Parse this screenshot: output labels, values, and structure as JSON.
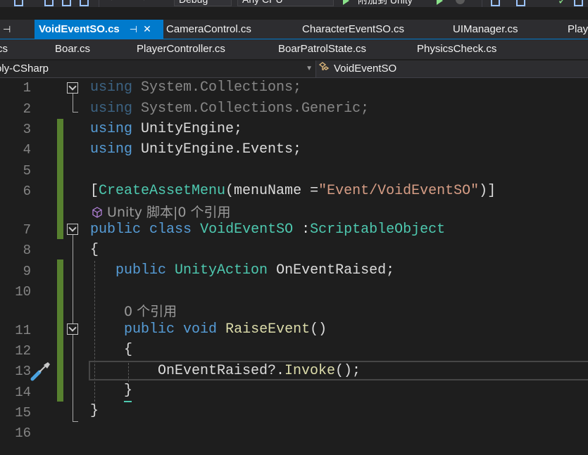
{
  "toolbar": {
    "config": "Debug",
    "platform": "Any CPU",
    "attach_label": "附加到 Unity"
  },
  "tabs_row1": [
    {
      "label": "VoidEventSO.cs",
      "active": true,
      "pin": "⊣",
      "close": "✕"
    },
    {
      "label": "CameraControl.cs"
    },
    {
      "label": "CharacterEventSO.cs"
    },
    {
      "label": "UIManager.cs"
    },
    {
      "label": "Play"
    }
  ],
  "tabs_row2": [
    {
      "label": "cs"
    },
    {
      "label": "Boar.cs"
    },
    {
      "label": "PlayerController.cs"
    },
    {
      "label": "BoarPatrolState.cs"
    },
    {
      "label": "PhysicsCheck.cs"
    }
  ],
  "navbar": {
    "project": "oly-CSharp",
    "class_name": "VoidEventSO"
  },
  "editor": {
    "line_numbers": [
      "1",
      "2",
      "3",
      "4",
      "5",
      "6",
      "7",
      "8",
      "9",
      "10",
      "11",
      "12",
      "13",
      "14",
      "15",
      "16"
    ],
    "lines": {
      "l1": {
        "kw": "using",
        "rest": " System.Collections;"
      },
      "l2": {
        "kw": "using",
        "rest": " System.Collections.Generic;"
      },
      "l3": {
        "kw": "using",
        "rest": " UnityEngine;"
      },
      "l4": {
        "kw": "using",
        "rest": " UnityEngine.Events;"
      },
      "l6": {
        "open": "[",
        "attr": "CreateAssetMenu",
        "mid": "(menuName =",
        "str": "\"Event/VoidEventSO\"",
        "close": ")]"
      },
      "l7": {
        "kw1": "public",
        "kw2": "class",
        "name": "VoidEventSO",
        "colon": " :",
        "base": "ScriptableObject"
      },
      "l8": "{",
      "l9": {
        "kw": "public",
        "type": "UnityAction",
        "rest": " OnEventRaised;"
      },
      "l11": {
        "kw1": "public",
        "kw2": "void",
        "name": "RaiseEvent",
        "rest": "()"
      },
      "l12": "{",
      "l13": {
        "pre": "OnEventRaised?.",
        "method": "Invoke",
        "post": "();"
      },
      "l14": "}",
      "l15": "}"
    },
    "lens_unity": "Unity 脚本|0 个引用",
    "lens_refs": "0 个引用"
  }
}
